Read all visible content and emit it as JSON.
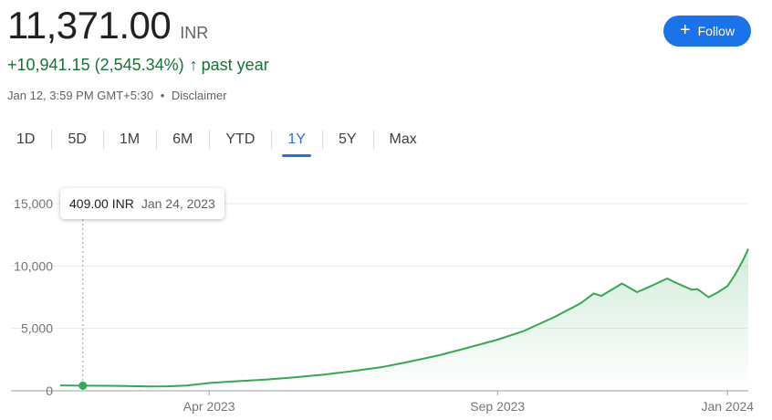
{
  "quote": {
    "price": "11,371.00",
    "currency": "INR",
    "change": "+10,941.15",
    "change_pct": "(2,545.34%)",
    "change_arrow": "↑",
    "period": "past year",
    "timestamp": "Jan 12, 3:59 PM GMT+5:30",
    "separator": "•",
    "disclaimer": "Disclaimer"
  },
  "follow_button": {
    "icon": "plus-icon",
    "label": "Follow"
  },
  "ranges": [
    {
      "label": "1D",
      "active": false
    },
    {
      "label": "5D",
      "active": false
    },
    {
      "label": "1M",
      "active": false
    },
    {
      "label": "6M",
      "active": false
    },
    {
      "label": "YTD",
      "active": false
    },
    {
      "label": "1Y",
      "active": true
    },
    {
      "label": "5Y",
      "active": false
    },
    {
      "label": "Max",
      "active": false
    }
  ],
  "tooltip": {
    "value": "409.00 INR",
    "date": "Jan 24, 2023"
  },
  "colors": {
    "line": "#34a853",
    "positive": "#137333",
    "accent": "#1a73e8",
    "grid": "#e8eaed",
    "axis_text": "#70757a"
  },
  "chart_data": {
    "type": "area",
    "ylim": [
      0,
      15000
    ],
    "y_ticks": [
      {
        "value": 0,
        "label": "0"
      },
      {
        "value": 5000,
        "label": "5,000"
      },
      {
        "value": 10000,
        "label": "10,000"
      },
      {
        "value": 15000,
        "label": "15,000"
      }
    ],
    "x_ticks": [
      {
        "date": "2023-04-01",
        "label": "Apr 2023"
      },
      {
        "date": "2023-09-01",
        "label": "Sep 2023"
      },
      {
        "date": "2024-01-01",
        "label": "Jan 2024"
      }
    ],
    "xlim": [
      "2023-01-12",
      "2024-01-12"
    ],
    "selected_point": {
      "date": "2023-01-24",
      "value": 409
    },
    "points": [
      {
        "date": "2023-01-12",
        "value": 430
      },
      {
        "date": "2023-01-24",
        "value": 409
      },
      {
        "date": "2023-02-05",
        "value": 400
      },
      {
        "date": "2023-02-15",
        "value": 380
      },
      {
        "date": "2023-02-28",
        "value": 350
      },
      {
        "date": "2023-03-10",
        "value": 360
      },
      {
        "date": "2023-03-20",
        "value": 420
      },
      {
        "date": "2023-04-01",
        "value": 620
      },
      {
        "date": "2023-04-15",
        "value": 760
      },
      {
        "date": "2023-05-01",
        "value": 900
      },
      {
        "date": "2023-05-15",
        "value": 1060
      },
      {
        "date": "2023-06-01",
        "value": 1300
      },
      {
        "date": "2023-06-15",
        "value": 1550
      },
      {
        "date": "2023-07-01",
        "value": 1880
      },
      {
        "date": "2023-07-15",
        "value": 2300
      },
      {
        "date": "2023-08-01",
        "value": 2850
      },
      {
        "date": "2023-08-15",
        "value": 3400
      },
      {
        "date": "2023-09-01",
        "value": 4100
      },
      {
        "date": "2023-09-15",
        "value": 4800
      },
      {
        "date": "2023-10-01",
        "value": 5900
      },
      {
        "date": "2023-10-15",
        "value": 7000
      },
      {
        "date": "2023-10-22",
        "value": 7800
      },
      {
        "date": "2023-10-26",
        "value": 7600
      },
      {
        "date": "2023-11-06",
        "value": 8600
      },
      {
        "date": "2023-11-14",
        "value": 7900
      },
      {
        "date": "2023-11-20",
        "value": 8300
      },
      {
        "date": "2023-11-30",
        "value": 9000
      },
      {
        "date": "2023-12-04",
        "value": 8700
      },
      {
        "date": "2023-12-10",
        "value": 8300
      },
      {
        "date": "2023-12-13",
        "value": 8100
      },
      {
        "date": "2023-12-16",
        "value": 8150
      },
      {
        "date": "2023-12-22",
        "value": 7500
      },
      {
        "date": "2023-12-27",
        "value": 7900
      },
      {
        "date": "2024-01-01",
        "value": 8400
      },
      {
        "date": "2024-01-05",
        "value": 9300
      },
      {
        "date": "2024-01-09",
        "value": 10400
      },
      {
        "date": "2024-01-12",
        "value": 11371
      }
    ]
  }
}
